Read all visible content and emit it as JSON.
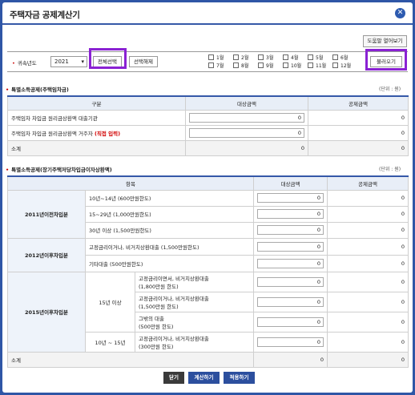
{
  "title": "주택자금 공제계산기",
  "help_button": "도움말 열어보기",
  "year": {
    "label": "귀속년도",
    "value": "2021",
    "select_all": "전체선택",
    "deselect_all": "선택해제",
    "months": [
      "1월",
      "2월",
      "3월",
      "4월",
      "5월",
      "6월",
      "7월",
      "8월",
      "9월",
      "10월",
      "11월",
      "12월"
    ],
    "view_button": "불러오기"
  },
  "section1": {
    "title": "특별소득공제(주택임차금)",
    "unit": "(단위 : 원)",
    "headers": [
      "구분",
      "대상금액",
      "공제금액"
    ],
    "rows": [
      {
        "label": "주택임차 차입금 원리금상환액 대출기관",
        "label_red": "",
        "amount": "0",
        "deduction": "0"
      },
      {
        "label": "주택임차 차입금 원리금상환액 거주자",
        "label_red": "(직접 입력)",
        "amount": "0",
        "deduction": "0"
      }
    ],
    "total": {
      "label": "소계",
      "amount": "0",
      "deduction": "0"
    }
  },
  "section2": {
    "title": "특별소득공제(장기주택저당차입금이자상환액)",
    "unit": "(단위 : 원)",
    "headers": [
      "항목",
      "대상금액",
      "공제금액"
    ],
    "groups": [
      {
        "name": "2011년이전차입분",
        "rows": [
          {
            "label": "10년~14년 (600만원한도)",
            "amount": "0",
            "deduction": "0"
          },
          {
            "label": "15~29년 (1,000만원한도)",
            "amount": "0",
            "deduction": "0"
          },
          {
            "label": "30년 이상 (1,500만원한도)",
            "amount": "0",
            "deduction": "0"
          }
        ]
      },
      {
        "name": "2012년이후차입분",
        "rows": [
          {
            "label": "고정금리이거나, 비거치상환대출 (1,500만원한도)",
            "amount": "0",
            "deduction": "0"
          },
          {
            "label": "기타대출 (500만원한도)",
            "amount": "0",
            "deduction": "0"
          }
        ]
      },
      {
        "name": "2015년이후차입분",
        "subgroups": [
          {
            "name": "15년 이상",
            "rows": [
              {
                "label": "고정금리이면서, 비거치상환대출",
                "label2": "(1,800만원 한도)",
                "amount": "0",
                "deduction": "0"
              },
              {
                "label": "고정금리이거나, 비거치상환대출",
                "label2": "(1,500만원 한도)",
                "amount": "0",
                "deduction": "0"
              },
              {
                "label": "그밖의 대출",
                "label2": "(500만원 한도)",
                "amount": "0",
                "deduction": "0"
              }
            ]
          },
          {
            "name": "10년 ~ 15년",
            "rows": [
              {
                "label": "고정금리이거나, 비거치상환대출",
                "label2": "(300만원 한도)",
                "amount": "0",
                "deduction": "0"
              }
            ]
          }
        ]
      }
    ],
    "total": {
      "label": "소계",
      "amount": "0",
      "deduction": "0"
    }
  },
  "footer": {
    "close": "닫기",
    "calculate": "계산하기",
    "apply": "적용하기"
  }
}
